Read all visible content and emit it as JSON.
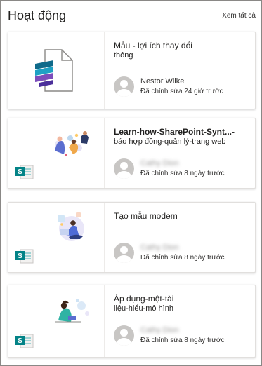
{
  "header": {
    "title": "Hoạt động",
    "see_all": "Xem tất cả"
  },
  "colors": {
    "sharepoint": "#038387",
    "sharepoint_dark": "#035a5c",
    "avatar": "#c8c6c4"
  },
  "cards": [
    {
      "title": "Mẫu - lợi ích thay đổi",
      "subtitle": "thông",
      "title_bold": false,
      "thumbnail_icon": "sway-document-icon",
      "person": "Nestor Wilke",
      "person_blurred": false,
      "edited": "Đã chỉnh sửa 24 giờ trước"
    },
    {
      "title": "Learn-how-SharePoint-Synt...-",
      "subtitle": "báo hợp đồng-quản lý-trang web",
      "title_bold": true,
      "thumbnail_icon": "sharepoint-page-icon",
      "person": "Cathy Dion",
      "person_blurred": true,
      "edited": "Đã chỉnh sửa 8 ngày trước"
    },
    {
      "title": "Tạo mẫu modem",
      "subtitle": "",
      "title_bold": false,
      "thumbnail_icon": "sharepoint-page-icon",
      "person": "Cathy Dion",
      "person_blurred": true,
      "edited": "Đã chỉnh sửa 8 ngày trước"
    },
    {
      "title": "Áp dụng-một-tài",
      "subtitle": "liệu-hiểu-mô hình",
      "title_bold": false,
      "thumbnail_icon": "sharepoint-page-icon",
      "person": "Cathy Dion",
      "person_blurred": true,
      "edited": "Đã chỉnh sửa 8 ngày trước"
    }
  ]
}
